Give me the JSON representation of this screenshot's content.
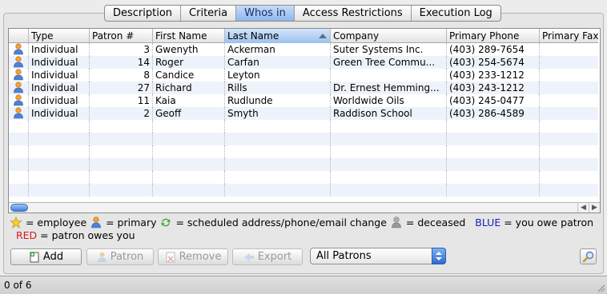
{
  "tabs": [
    {
      "label": "Description",
      "active": false
    },
    {
      "label": "Criteria",
      "active": false
    },
    {
      "label": "Whos in",
      "active": true
    },
    {
      "label": "Access Restrictions",
      "active": false
    },
    {
      "label": "Execution Log",
      "active": false
    }
  ],
  "table": {
    "columns": [
      "",
      "Type",
      "Patron #",
      "First Name",
      "Last Name",
      "Company",
      "Primary Phone",
      "Primary Fax"
    ],
    "sorted_column": "Last Name",
    "sort_direction": "ascending",
    "rows": [
      {
        "icon": "person-icon",
        "type": "Individual",
        "patron": "3",
        "first": "Gwenyth",
        "last": "Ackerman",
        "company": "Suter Systems Inc.",
        "phone": "(403) 289-7654",
        "fax": ""
      },
      {
        "icon": "person-icon",
        "type": "Individual",
        "patron": "14",
        "first": "Roger",
        "last": "Carfan",
        "company": "Green Tree Commu...",
        "phone": "(403) 254-5674",
        "fax": ""
      },
      {
        "icon": "person-icon",
        "type": "Individual",
        "patron": "8",
        "first": "Candice",
        "last": "Leyton",
        "company": "",
        "phone": "(403) 233-1212",
        "fax": ""
      },
      {
        "icon": "person-icon",
        "type": "Individual",
        "patron": "27",
        "first": "Richard",
        "last": "Rills",
        "company": "Dr. Ernest Hemming...",
        "phone": "(403) 243-1212",
        "fax": ""
      },
      {
        "icon": "person-icon",
        "type": "Individual",
        "patron": "11",
        "first": "Kaia",
        "last": "Rudlunde",
        "company": "Worldwide Oils",
        "phone": "(403) 245-0477",
        "fax": ""
      },
      {
        "icon": "person-icon",
        "type": "Individual",
        "patron": "2",
        "first": "Geoff",
        "last": "Smyth",
        "company": "Raddison School",
        "phone": "(403) 286-4589",
        "fax": ""
      }
    ]
  },
  "legend": {
    "employee": "= employee",
    "primary": "= primary",
    "scheduled": "= scheduled address/phone/email change",
    "deceased": "= deceased",
    "blue_word": "BLUE",
    "blue_text": "= you owe patron",
    "red_word": "RED",
    "red_text": "= patron owes you"
  },
  "buttons": {
    "add": "Add",
    "patron": "Patron",
    "remove": "Remove",
    "export": "Export"
  },
  "filter_select": {
    "value": "All Patrons"
  },
  "status": {
    "text": "0 of 6"
  },
  "colors": {
    "blue": "#1822b8",
    "red": "#d11b1b",
    "active_tab": "#8db7ec"
  }
}
